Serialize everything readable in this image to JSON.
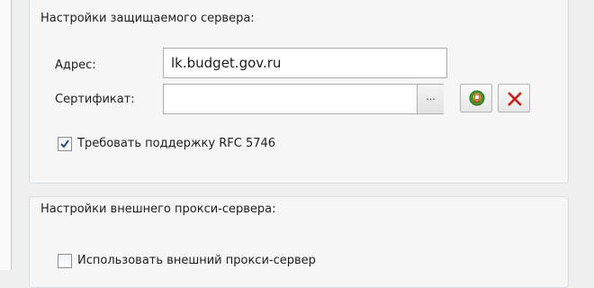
{
  "server_group": {
    "title": "Настройки защищаемого сервера:",
    "address_label": "Адрес:",
    "address_value": "lk.budget.gov.ru",
    "certificate_label": "Сертификат:",
    "certificate_value": "",
    "browse_label": "...",
    "select_cert_icon": "certificate-icon",
    "clear_cert_icon": "red-x-icon",
    "rfc_checkbox_label": "Требовать поддержку RFC 5746",
    "rfc_checked": true
  },
  "proxy_group": {
    "title": "Настройки внешнего прокси-сервера:",
    "use_proxy_label": "Использовать внешний прокси-сервер",
    "use_proxy_checked": false
  },
  "colors": {
    "group_border": "#d5dfe5",
    "check_mark": "#2b4a7c",
    "clear_x": "#c8201c",
    "cert_green": "#3f9a2e"
  }
}
